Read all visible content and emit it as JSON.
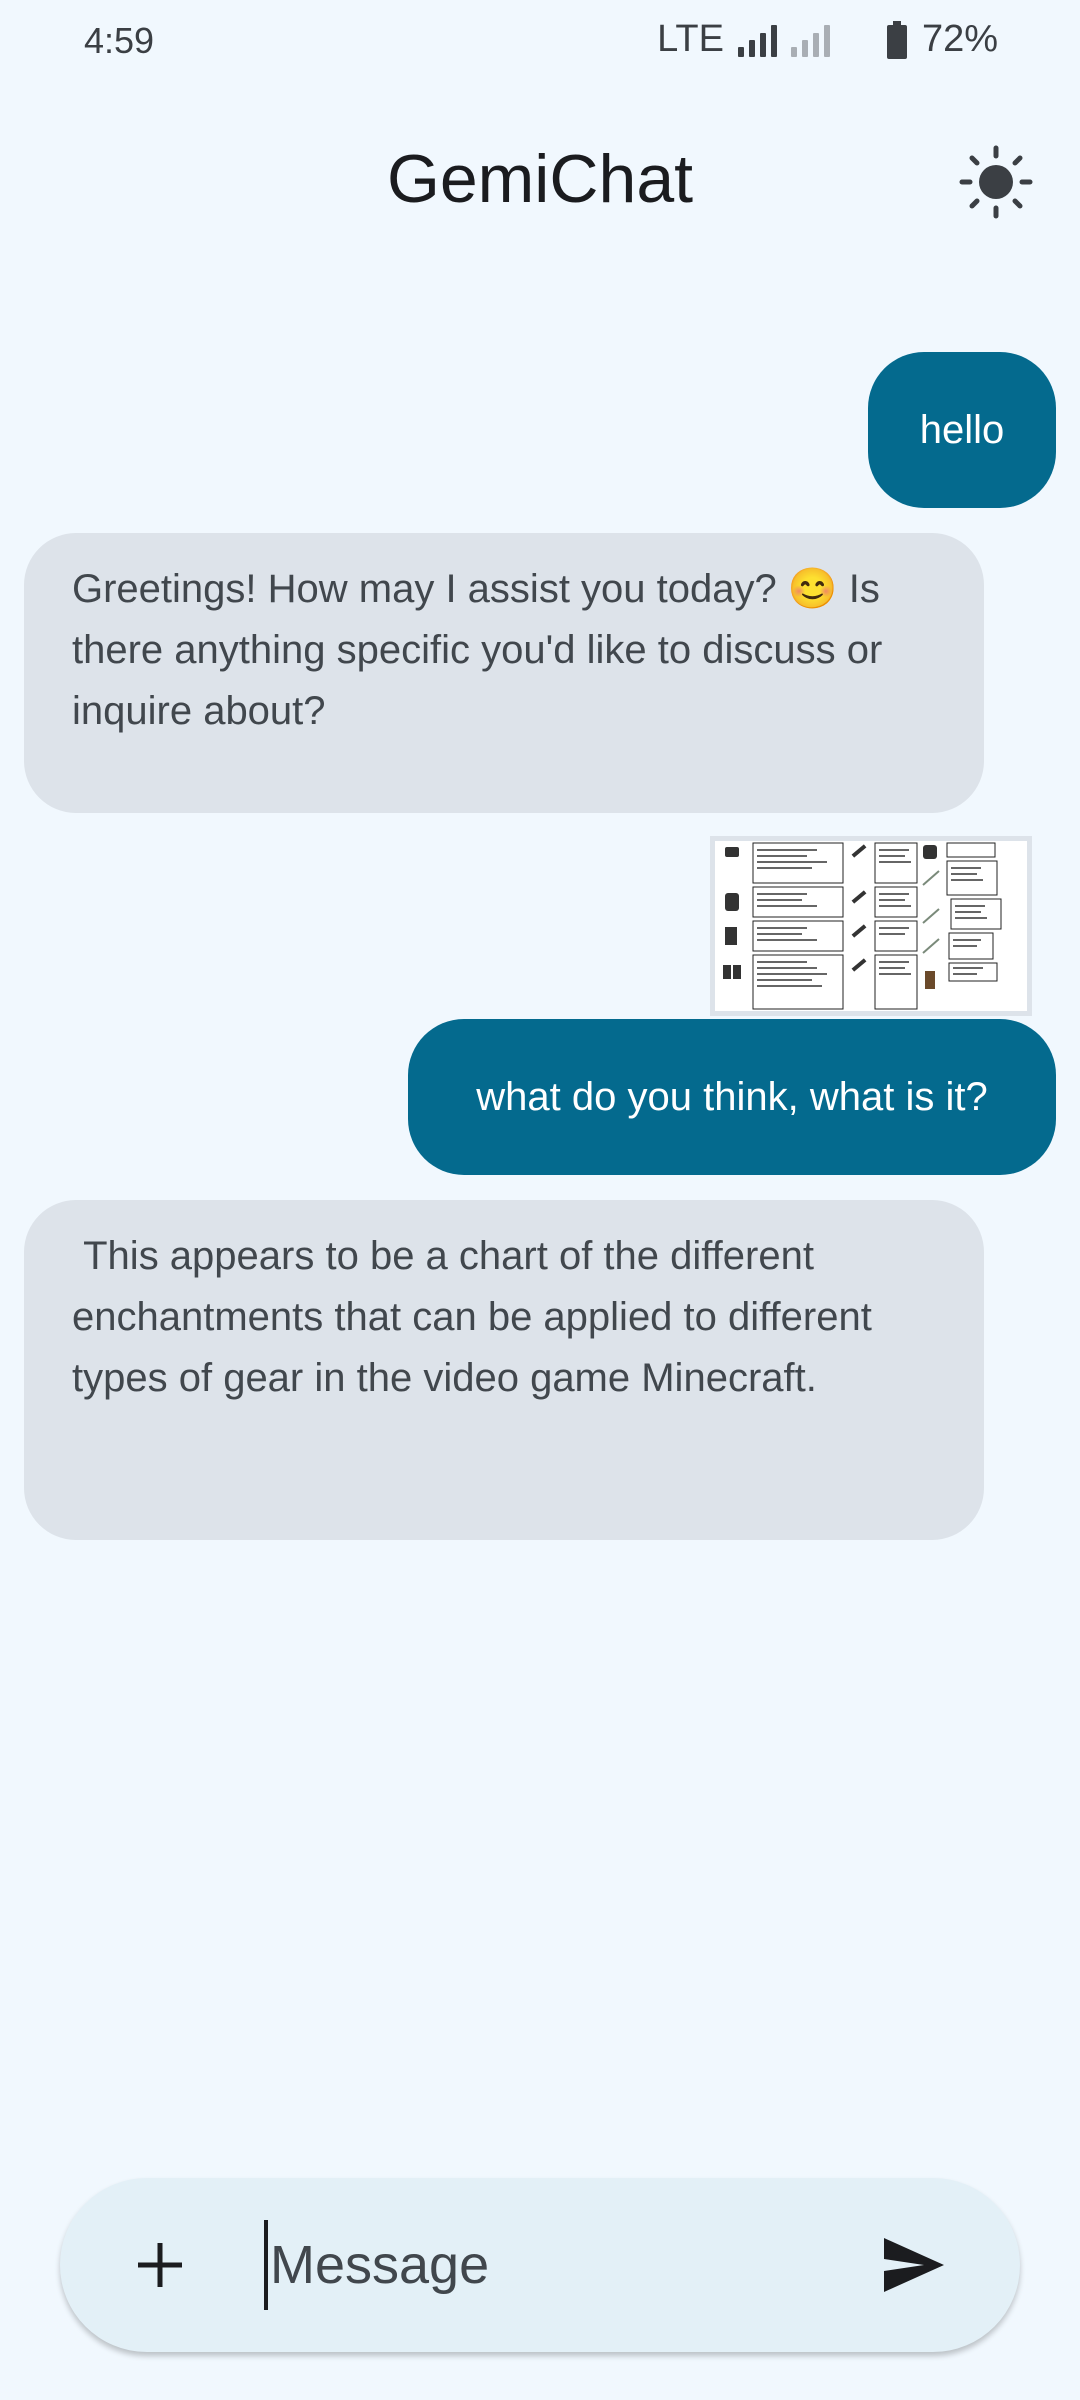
{
  "status_bar": {
    "time": "4:59",
    "network": "LTE",
    "battery": "72%"
  },
  "header": {
    "title": "GemiChat",
    "theme_icon": "sun-icon"
  },
  "messages": [
    {
      "role": "user",
      "text": "hello"
    },
    {
      "role": "bot",
      "text": "Greetings! How may I assist you today? 😊 Is there anything specific you'd like to discuss or inquire about?"
    },
    {
      "role": "user",
      "attachment": "image",
      "text": "what do you think, what is it?"
    },
    {
      "role": "bot",
      "text": " This appears to be a chart of the different enchantments that can be applied to different types of gear in the video game Minecraft."
    }
  ],
  "input": {
    "placeholder": "Message",
    "add_icon": "plus-icon",
    "send_icon": "send-icon"
  },
  "colors": {
    "background": "#f1f8fe",
    "user_bubble": "#046a8e",
    "bot_bubble": "#dde3ea"
  }
}
